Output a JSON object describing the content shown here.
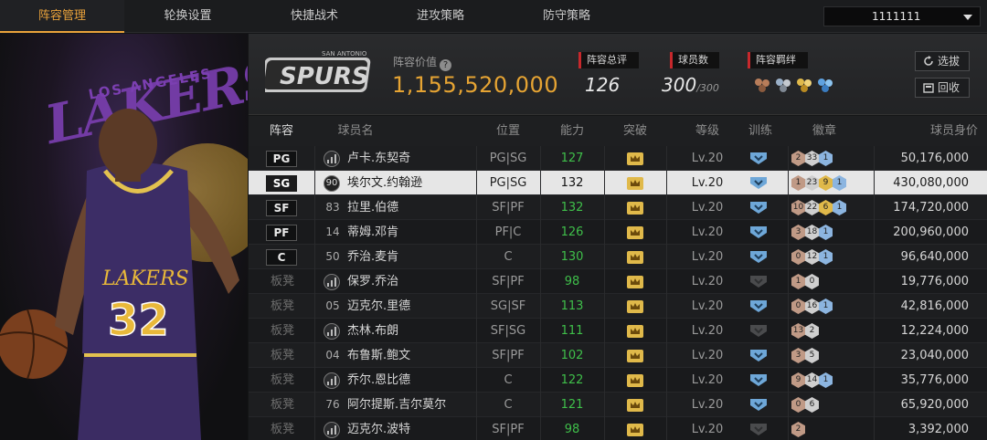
{
  "nav": {
    "tabs": [
      "阵容管理",
      "轮换设置",
      "快捷战术",
      "进攻策略",
      "防守策略"
    ],
    "active_tab": 0,
    "team_select_value": "1111111"
  },
  "portrait": {
    "logo_text": "LAKERS",
    "logo_top_text": "LOS ANGELES"
  },
  "summary": {
    "value_label": "阵容价值",
    "value": "1,155,520,000",
    "rating_label": "阵容总评",
    "rating": "126",
    "player_count_label": "球员数",
    "player_count": "300",
    "player_count_max": "/300",
    "bond_label": "阵容羁绊",
    "team_logo_text": "SPURS",
    "team_logo_sub": "SAN ANTONIO"
  },
  "buttons": {
    "select_label": "选拔",
    "recycle_label": "回收"
  },
  "table": {
    "headers": [
      "阵容",
      "球员名",
      "位置",
      "能力",
      "突破",
      "等级",
      "训练",
      "徽章",
      "球员身价"
    ],
    "rows": [
      {
        "slot": "PG",
        "number": "",
        "name": "卢卡.东契奇",
        "pos": "PG|SG",
        "ability": "127",
        "level": "Lv.20",
        "badges": [
          "2",
          "33",
          "1"
        ],
        "price": "50,176,000"
      },
      {
        "slot": "SG",
        "number": "90",
        "name": "埃尔文.约翰逊",
        "pos": "PG|SG",
        "ability": "132",
        "level": "Lv.20",
        "badges": [
          "1",
          "23",
          "9",
          "1"
        ],
        "price": "430,080,000",
        "selected": true
      },
      {
        "slot": "SF",
        "number": "83",
        "name": "拉里.伯德",
        "pos": "SF|PF",
        "ability": "132",
        "level": "Lv.20",
        "badges": [
          "10",
          "22",
          "6",
          "1"
        ],
        "price": "174,720,000"
      },
      {
        "slot": "PF",
        "number": "14",
        "name": "蒂姆.邓肯",
        "pos": "PF|C",
        "ability": "126",
        "level": "Lv.20",
        "badges": [
          "3",
          "18",
          "1"
        ],
        "price": "200,960,000"
      },
      {
        "slot": "C",
        "number": "50",
        "name": "乔治.麦肯",
        "pos": "C",
        "ability": "130",
        "level": "Lv.20",
        "badges": [
          "0",
          "12",
          "1"
        ],
        "price": "96,640,000"
      },
      {
        "slot": "板凳",
        "number": "",
        "name": "保罗.乔治",
        "pos": "SF|PF",
        "ability": "98",
        "level": "Lv.20",
        "badges": [
          "1",
          "0"
        ],
        "price": "19,776,000"
      },
      {
        "slot": "板凳",
        "number": "05",
        "name": "迈克尔.里德",
        "pos": "SG|SF",
        "ability": "113",
        "level": "Lv.20",
        "badges": [
          "0",
          "16",
          "1"
        ],
        "price": "42,816,000"
      },
      {
        "slot": "板凳",
        "number": "",
        "name": "杰林.布朗",
        "pos": "SF|SG",
        "ability": "111",
        "level": "Lv.20",
        "badges": [
          "13",
          "2"
        ],
        "price": "12,224,000"
      },
      {
        "slot": "板凳",
        "number": "04",
        "name": "布鲁斯.鲍文",
        "pos": "SF|PF",
        "ability": "102",
        "level": "Lv.20",
        "badges": [
          "3",
          "5"
        ],
        "price": "23,040,000"
      },
      {
        "slot": "板凳",
        "number": "",
        "name": "乔尔.恩比德",
        "pos": "C",
        "ability": "122",
        "level": "Lv.20",
        "badges": [
          "9",
          "14",
          "1"
        ],
        "price": "35,776,000"
      },
      {
        "slot": "板凳",
        "number": "76",
        "name": "阿尔提斯.吉尔莫尔",
        "pos": "C",
        "ability": "121",
        "level": "Lv.20",
        "badges": [
          "0",
          "6"
        ],
        "price": "65,920,000"
      },
      {
        "slot": "板凳",
        "number": "",
        "name": "迈克尔.波特",
        "pos": "SF|PF",
        "ability": "98",
        "level": "Lv.20",
        "badges": [
          "2"
        ],
        "price": "3,392,000"
      }
    ]
  },
  "colors": {
    "accent": "#e9a23b",
    "ability_green": "#3fbf4a",
    "tag_red": "#c7282c"
  }
}
